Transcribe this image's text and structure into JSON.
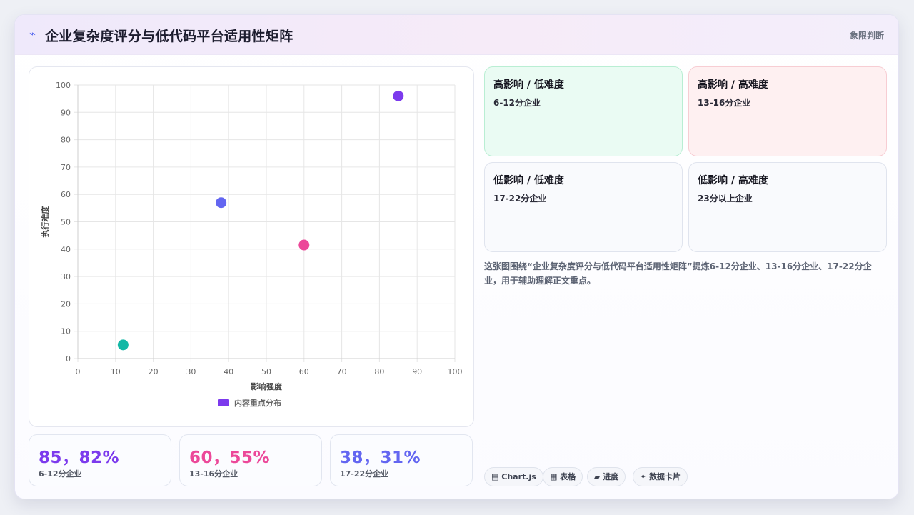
{
  "header": {
    "icon": "lightning-icon",
    "title": "企业复杂度评分与低代码平台适用性矩阵",
    "tag": "象限判断"
  },
  "chart_data": {
    "type": "scatter",
    "xlabel": "影响强度",
    "ylabel": "执行难度",
    "xlim": [
      0,
      100
    ],
    "ylim": [
      0,
      100
    ],
    "xticks": [
      0,
      10,
      20,
      30,
      40,
      50,
      60,
      70,
      80,
      90,
      100
    ],
    "yticks": [
      0,
      10,
      20,
      30,
      40,
      50,
      60,
      70,
      80,
      90,
      100
    ],
    "grid": true,
    "legend": {
      "label": "内容重点分布",
      "position": "bottom",
      "color": "#7c3aed"
    },
    "points": [
      {
        "x": 85,
        "y": 96,
        "color": "#7c3aed"
      },
      {
        "x": 60,
        "y": 41.5,
        "color": "#ec4899"
      },
      {
        "x": 38,
        "y": 57,
        "color": "#6366f1"
      },
      {
        "x": 12,
        "y": 5,
        "color": "#14b8a6"
      }
    ]
  },
  "stats": [
    {
      "value": "85，82%",
      "label": "6-12分企业",
      "color": "#7c3aed"
    },
    {
      "value": "60，55%",
      "label": "13-16分企业",
      "color": "#ec4899"
    },
    {
      "value": "38，31%",
      "label": "17-22分企业",
      "color": "#6366f1"
    }
  ],
  "quadrants": [
    {
      "title": "高影响 / 低难度",
      "sub": "6-12分企业"
    },
    {
      "title": "高影响 / 高难度",
      "sub": "13-16分企业"
    },
    {
      "title": "低影响 / 低难度",
      "sub": "17-22分企业"
    },
    {
      "title": "低影响 / 高难度",
      "sub": "23分以上企业"
    }
  ],
  "description": "这张图围绕“企业复杂度评分与低代码平台适用性矩阵”提炼6-12分企业、13-16分企业、17-22分企业，用于辅助理解正文重点。",
  "pills": [
    {
      "icon": "chart-icon",
      "glyph": "▤",
      "label": "Chart.js"
    },
    {
      "icon": "table-icon",
      "glyph": "▦",
      "label": "表格"
    },
    {
      "icon": "progress-icon",
      "glyph": "▰",
      "label": "进度"
    },
    {
      "icon": "sparkle-icon",
      "glyph": "✦",
      "label": "数据卡片"
    }
  ]
}
